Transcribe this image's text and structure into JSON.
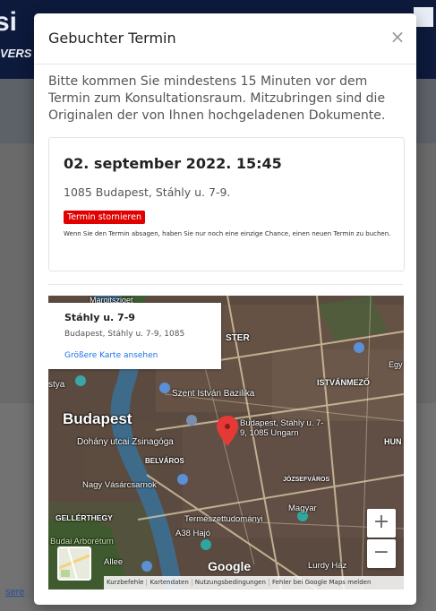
{
  "background": {
    "logo": "si",
    "sub": "VERS",
    "link": "sere"
  },
  "modal": {
    "title": "Gebuchter Termin",
    "close": "×",
    "intro": "Bitte kommen Sie mindestens 15 Minuten vor dem Termin zum Konsultationsraum. Mitzubringen sind die Originalen der von Ihnen hochgeladenen Dokumente.",
    "appointment": {
      "date": "02. september 2022. 15:45",
      "address": "1085 Budapest, Stáhly u. 7-9.",
      "cancel_label": "Termin stornieren",
      "warning": "Wenn Sie den Termin absagen, haben Sie nur noch eine einzige Chance, einen neuen Termin zu buchen."
    }
  },
  "map": {
    "info": {
      "title": "Stáhly u. 7-9",
      "address": "Budapest, Stáhly u. 7-9, 1085",
      "link": "Größere Karte ansehen"
    },
    "labels": {
      "margitsziget": "Margitsziget",
      "ster": "STER",
      "stya": "stya",
      "szent_istvan": "Szent István Bazilika",
      "istvanmezo": "ISTVÁNMEZŐ",
      "egy": "Egy",
      "budapest": "Budapest",
      "pin_label": "Budapest, Stáhly u. 7-9, 1085 Ungarn",
      "dohany": "Dohány utcai Zsinagóga",
      "belvaros": "BELVÁROS",
      "hun": "HUN",
      "nagy_vasarcsarnok": "Nagy Vásárcsarnok",
      "jozsefvaros": "JÓZSEFVÁROS",
      "gellerthegy": "GELLÉRTHEGY",
      "termeszet": "Természettudományi",
      "magyar": "Magyar",
      "a38": "A38 Hajó",
      "arboretum": "Budai Arborétum",
      "allee": "Allee",
      "lurdy": "Lurdy Ház",
      "google": "Google"
    },
    "zoom_in": "+",
    "zoom_out": "−",
    "footer": [
      "Kurzbefehle",
      "Kartendaten",
      "Nutzungsbedingungen",
      "Fehler bei Google Maps melden"
    ],
    "colors": {
      "pin": "#e53935",
      "link": "#1a73e8",
      "cancel": "#e00000"
    }
  }
}
